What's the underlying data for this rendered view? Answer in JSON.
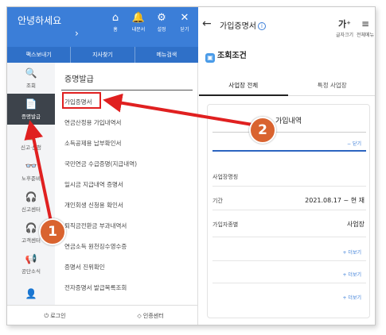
{
  "drawer": {
    "greeting": "안녕하세요",
    "chevron": "›",
    "header_icons": [
      {
        "icon": "home-icon",
        "glyph": "⌂",
        "label": "홈"
      },
      {
        "icon": "bell-icon",
        "glyph": "🔔",
        "label": "내문서"
      },
      {
        "icon": "gear-icon",
        "glyph": "⚙",
        "label": "설정"
      },
      {
        "icon": "close-icon",
        "glyph": "✕",
        "label": "닫기"
      }
    ],
    "quick": [
      "팩스보내기",
      "지사찾기",
      "메뉴검색"
    ],
    "side": [
      {
        "glyph": "🔍",
        "label": "조회"
      },
      {
        "glyph": "📄",
        "label": "증명발급"
      },
      {
        "glyph": "📋",
        "label": "신고·신청"
      },
      {
        "glyph": "👓",
        "label": "노후준비"
      },
      {
        "glyph": "🎧",
        "label": "신고센터"
      },
      {
        "glyph": "🎧",
        "label": "고객센터"
      },
      {
        "glyph": "📢",
        "label": "공단소식"
      },
      {
        "glyph": "👤",
        "label": ""
      }
    ],
    "content_title": "증명발급",
    "items": [
      "가입증명서",
      "연금산정용 가입내역서",
      "소득공제용 납부확인서",
      "국민연금 수급증명(지급내역)",
      "일시금 지급내역 증명서",
      "개인회생 신청용 확인서",
      "퇴직금전환금 부과내역서",
      "연금소득 원천징수영수증",
      "증명서 진위확인",
      "전자증명서 발급목록조회"
    ],
    "footer": {
      "login": "로그인",
      "auth": "인증센터"
    }
  },
  "panel": {
    "back": "←",
    "title": "가입증명서",
    "info": "i",
    "font_size": {
      "glyph": "가⁺",
      "label": "글자크기"
    },
    "menu": {
      "glyph": "≡",
      "label": "전체메뉴"
    },
    "condition": "조회조건",
    "tabs": [
      "사업장 전체",
      "특정 사업장"
    ],
    "card_title": "가입내역",
    "collapse": "− 닫기",
    "rows": [
      {
        "label": "사업장명칭",
        "value": ""
      },
      {
        "label": "기간",
        "value": "2021.08.17 ~ 현 재"
      },
      {
        "label": "가입자종별",
        "value": "사업장"
      }
    ],
    "more_label": "+ 더보기"
  },
  "annotations": {
    "badge1": "1",
    "badge2": "2",
    "color": "#e02020"
  }
}
